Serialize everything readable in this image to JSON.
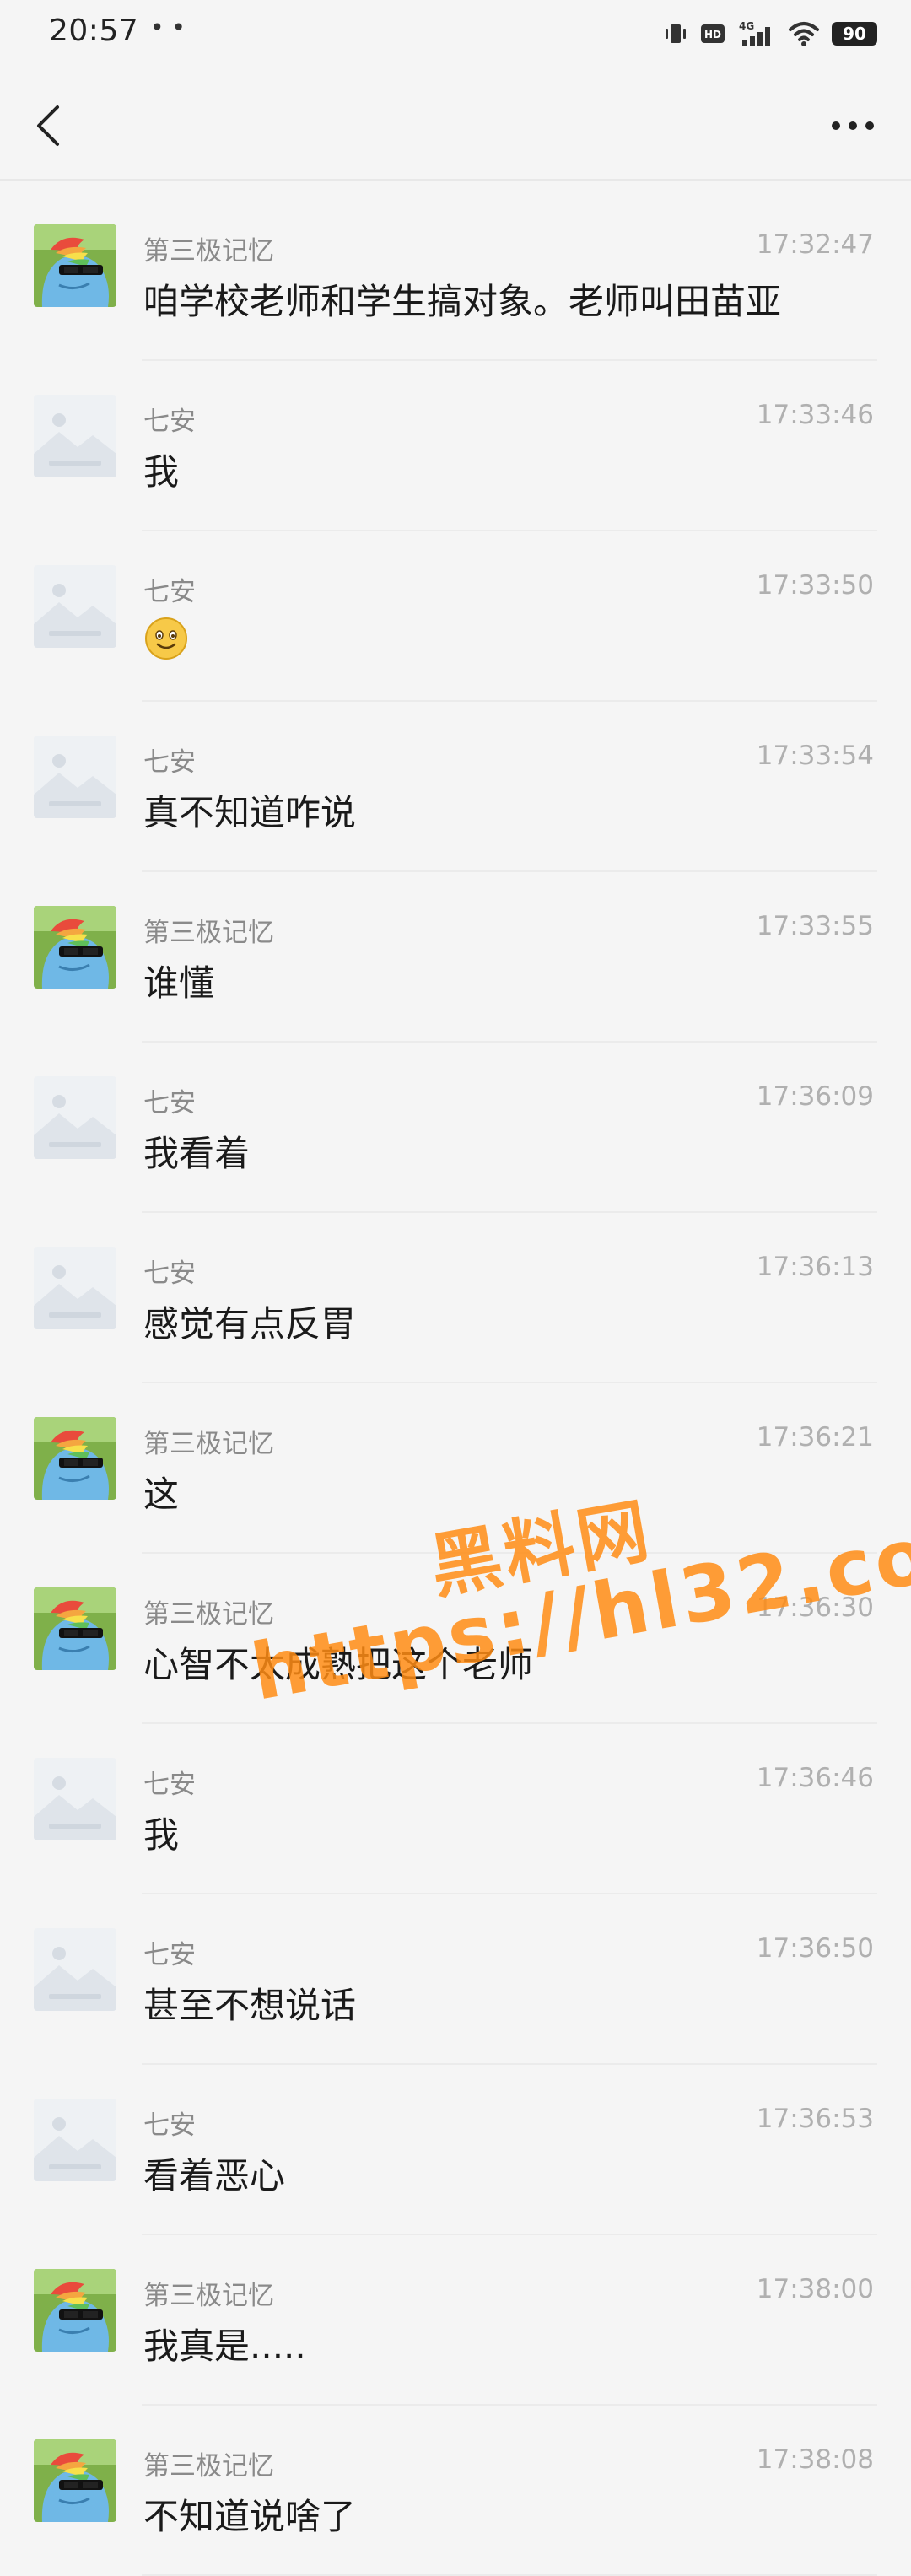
{
  "status_bar": {
    "time": "20:57",
    "dots": "• •",
    "network": "4G",
    "battery": "90"
  },
  "header": {
    "back_icon": "chevron-left-icon",
    "more_icon": "more-horizontal-icon"
  },
  "colors": {
    "background": "#f5f5f5",
    "watermark": "#ff8c14"
  },
  "messages": [
    {
      "sender": "第三极记忆",
      "time": "17:32:47",
      "text": "咱学校老师和学生搞对象。老师叫田苗亚",
      "avatar": "pony"
    },
    {
      "sender": "七安",
      "time": "17:33:46",
      "text": "我",
      "avatar": "placeholder"
    },
    {
      "sender": "七安",
      "time": "17:33:50",
      "text": "",
      "emoji": "smile-emoji",
      "avatar": "placeholder"
    },
    {
      "sender": "七安",
      "time": "17:33:54",
      "text": "真不知道咋说",
      "avatar": "placeholder"
    },
    {
      "sender": "第三极记忆",
      "time": "17:33:55",
      "text": "谁懂",
      "avatar": "pony"
    },
    {
      "sender": "七安",
      "time": "17:36:09",
      "text": "我看着",
      "avatar": "placeholder"
    },
    {
      "sender": "七安",
      "time": "17:36:13",
      "text": "感觉有点反胃",
      "avatar": "placeholder"
    },
    {
      "sender": "第三极记忆",
      "time": "17:36:21",
      "text": "这",
      "avatar": "pony"
    },
    {
      "sender": "第三极记忆",
      "time": "17:36:30",
      "text": "心智不太成熟把这个老师",
      "avatar": "pony"
    },
    {
      "sender": "七安",
      "time": "17:36:46",
      "text": "我",
      "avatar": "placeholder"
    },
    {
      "sender": "七安",
      "time": "17:36:50",
      "text": "甚至不想说话",
      "avatar": "placeholder"
    },
    {
      "sender": "七安",
      "time": "17:36:53",
      "text": "看着恶心",
      "avatar": "placeholder"
    },
    {
      "sender": "第三极记忆",
      "time": "17:38:00",
      "text": "我真是.....",
      "avatar": "pony"
    },
    {
      "sender": "第三极记忆",
      "time": "17:38:08",
      "text": "不知道说啥了",
      "avatar": "pony"
    }
  ],
  "watermark": {
    "line1": "黑料网",
    "line2": "https://hl32.co"
  }
}
